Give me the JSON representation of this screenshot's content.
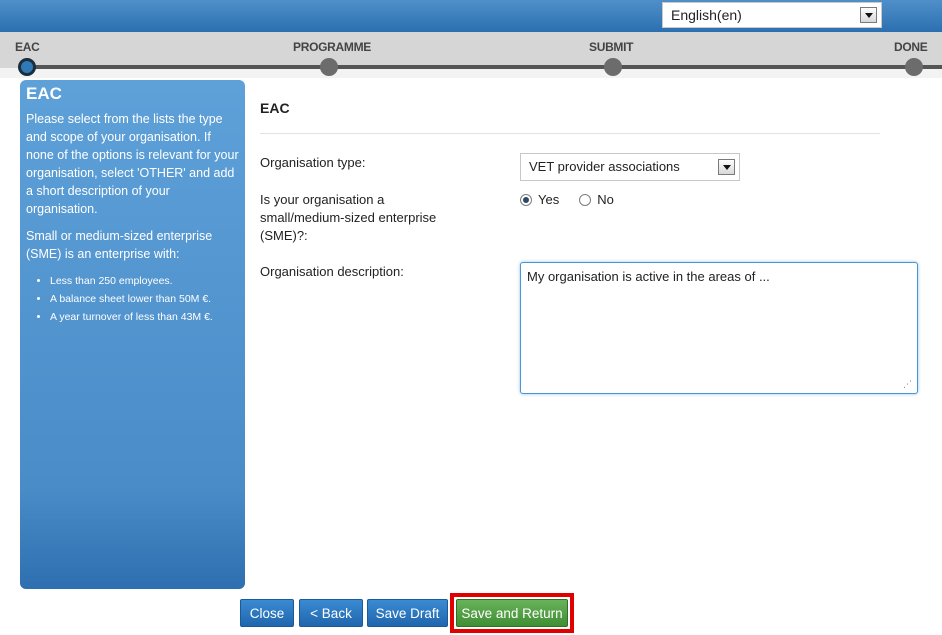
{
  "language_select": {
    "value": "English(en)"
  },
  "steps": [
    {
      "label": "EAC",
      "active": true
    },
    {
      "label": "PROGRAMME",
      "active": false
    },
    {
      "label": "SUBMIT",
      "active": false
    },
    {
      "label": "DONE",
      "active": false
    }
  ],
  "sidebar": {
    "title": "EAC",
    "paragraph1": "Please select from the lists the type and scope of your organisation. If none of the options is relevant for your organisation, select 'OTHER' and add a short description of your organisation.",
    "paragraph2": "Small or medium-sized enterprise (SME) is an enterprise with:",
    "bullets": [
      "Less than 250 employees.",
      "A balance sheet lower than 50M €.",
      "A year turnover of less than 43M €."
    ]
  },
  "form": {
    "section_title": "EAC",
    "org_type_label": "Organisation type:",
    "org_type_value": "VET provider associations",
    "sme_label": "Is your organisation a small/medium-sized enterprise (SME)?:",
    "sme_yes": "Yes",
    "sme_no": "No",
    "sme_selected": "Yes",
    "description_label": "Organisation description:",
    "description_value": "My organisation is active in the areas of ..."
  },
  "buttons": {
    "close": "Close",
    "back": "< Back",
    "save_draft": "Save Draft",
    "save_return": "Save and Return"
  },
  "colors": {
    "header_blue": "#2c6fb0",
    "sidebar_blue": "#4a8cc8",
    "button_blue": "#1f66ad",
    "button_green": "#3f8f34",
    "highlight_red": "#e00000"
  }
}
